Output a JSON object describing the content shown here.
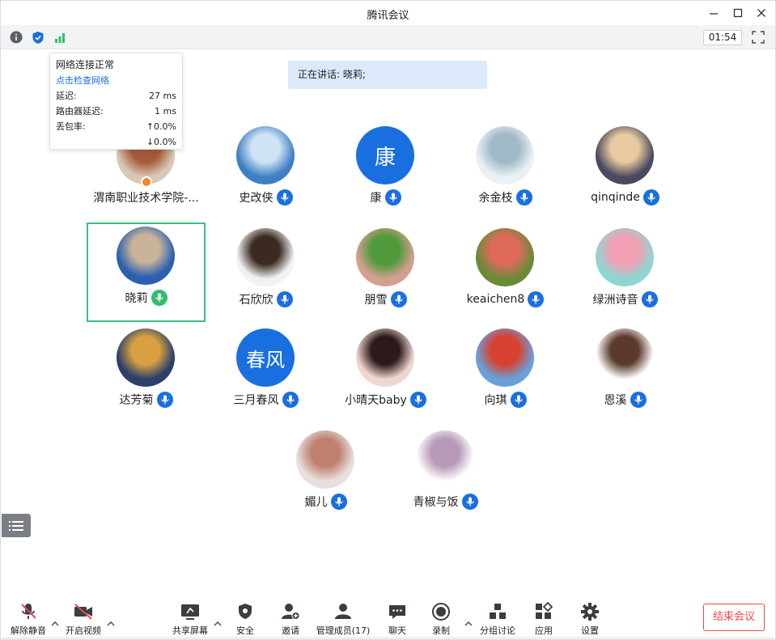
{
  "window": {
    "title": "腾讯会议"
  },
  "status": {
    "timer": "01:54"
  },
  "network_tooltip": {
    "title": "网络连接正常",
    "link": "点击检查网络",
    "rows": [
      {
        "label": "延迟:",
        "value": "27 ms"
      },
      {
        "label": "路由器延迟:",
        "value": "1 ms"
      },
      {
        "label": "丢包率:",
        "value": "↑0.0%"
      }
    ],
    "loss_down": "↓0.0%"
  },
  "speaking": {
    "text": "正在讲话: 晓莉;"
  },
  "participants": [
    {
      "name": "渭南职业技术学院-...",
      "avatar_text": "",
      "colors": [
        "#d8c8b4",
        "#a55a3a"
      ],
      "mic": "none",
      "host": true
    },
    {
      "name": "史改侠",
      "avatar_text": "",
      "colors": [
        "#3f7fc4",
        "#cfe3f5"
      ],
      "mic": "blue"
    },
    {
      "name": "康",
      "avatar_text": "康",
      "colors": [
        "#1a6fe0",
        "#1a6fe0"
      ],
      "mic": "blue"
    },
    {
      "name": "余金枝",
      "avatar_text": "",
      "colors": [
        "#eaf1f4",
        "#9fb9c6"
      ],
      "mic": "blue"
    },
    {
      "name": "qinqinde",
      "avatar_text": "",
      "colors": [
        "#4a4a5e",
        "#e8c9a0"
      ],
      "mic": "blue"
    },
    {
      "name": "晓莉",
      "avatar_text": "",
      "colors": [
        "#2b5fb0",
        "#c9b39a"
      ],
      "mic": "green"
    },
    {
      "name": "石欣欣",
      "avatar_text": "",
      "colors": [
        "#f2f2f2",
        "#3a2a22"
      ],
      "mic": "blue"
    },
    {
      "name": "朋雪",
      "avatar_text": "",
      "colors": [
        "#d3a090",
        "#4f9a3a"
      ],
      "mic": "blue"
    },
    {
      "name": "keaichen8",
      "avatar_text": "",
      "colors": [
        "#6a8a3a",
        "#e06a5a"
      ],
      "mic": "blue"
    },
    {
      "name": "绿洲诗音",
      "avatar_text": "",
      "colors": [
        "#8fd6d0",
        "#f2a0b4"
      ],
      "mic": "blue"
    },
    {
      "name": "达芳菊",
      "avatar_text": "",
      "colors": [
        "#2b3f6a",
        "#d8a040"
      ],
      "mic": "blue"
    },
    {
      "name": "三月春风",
      "avatar_text": "春风",
      "colors": [
        "#1a6fe0",
        "#1a6fe0"
      ],
      "mic": "blue"
    },
    {
      "name": "小晴天baby",
      "avatar_text": "",
      "colors": [
        "#f0d6d0",
        "#2a1a1a"
      ],
      "mic": "blue"
    },
    {
      "name": "向琪",
      "avatar_text": "",
      "colors": [
        "#6aa0d8",
        "#d84030"
      ],
      "mic": "blue"
    },
    {
      "name": "恩溪",
      "avatar_text": "",
      "colors": [
        "#ffffff",
        "#5a3a2a"
      ],
      "mic": "blue"
    },
    {
      "name": "媚儿",
      "avatar_text": "",
      "colors": [
        "#e8e0dc",
        "#c08070"
      ],
      "mic": "blue"
    },
    {
      "name": "青椒与饭",
      "avatar_text": "",
      "colors": [
        "#ffffff",
        "#b89ab8"
      ],
      "mic": "blue"
    }
  ],
  "toolbar": {
    "unmute": "解除静音",
    "start_video": "开启视频",
    "share_screen": "共享屏幕",
    "security": "安全",
    "invite": "邀请",
    "manage_members": "管理成员(17)",
    "chat": "聊天",
    "record": "录制",
    "breakout": "分组讨论",
    "apps": "应用",
    "settings": "设置",
    "end_meeting": "结束会议"
  },
  "colors": {
    "accent": "#1a6fe0",
    "speaking_bg": "#dbe9fb",
    "active_border": "#34c37a",
    "danger": "#e94b4b"
  }
}
